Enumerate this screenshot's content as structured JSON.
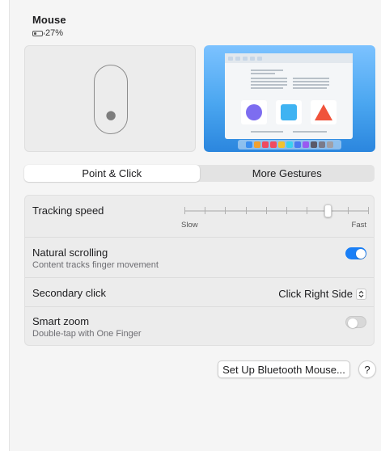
{
  "header": {
    "title": "Mouse",
    "battery_text": "27%",
    "battery_icon": "battery-low-icon"
  },
  "preview": {
    "mouse_icon": "magic-mouse-illustration",
    "desktop_preview": "trackpad-gesture-preview"
  },
  "tabs": [
    {
      "label": "Point & Click",
      "selected": true
    },
    {
      "label": "More Gestures",
      "selected": false
    }
  ],
  "settings": {
    "tracking_speed": {
      "label": "Tracking speed",
      "min_label": "Slow",
      "max_label": "Fast",
      "value_fraction": 0.78,
      "tick_count": 10
    },
    "natural_scrolling": {
      "label": "Natural scrolling",
      "description": "Content tracks finger movement",
      "enabled": true
    },
    "secondary_click": {
      "label": "Secondary click",
      "value": "Click Right Side"
    },
    "smart_zoom": {
      "label": "Smart zoom",
      "description": "Double-tap with One Finger",
      "enabled": false
    }
  },
  "footer": {
    "setup_button": "Set Up Bluetooth Mouse...",
    "help_button": "?"
  },
  "colors": {
    "accent": "#1a7ff6",
    "panel_bg": "#f5f5f5",
    "group_bg": "#ececec"
  }
}
